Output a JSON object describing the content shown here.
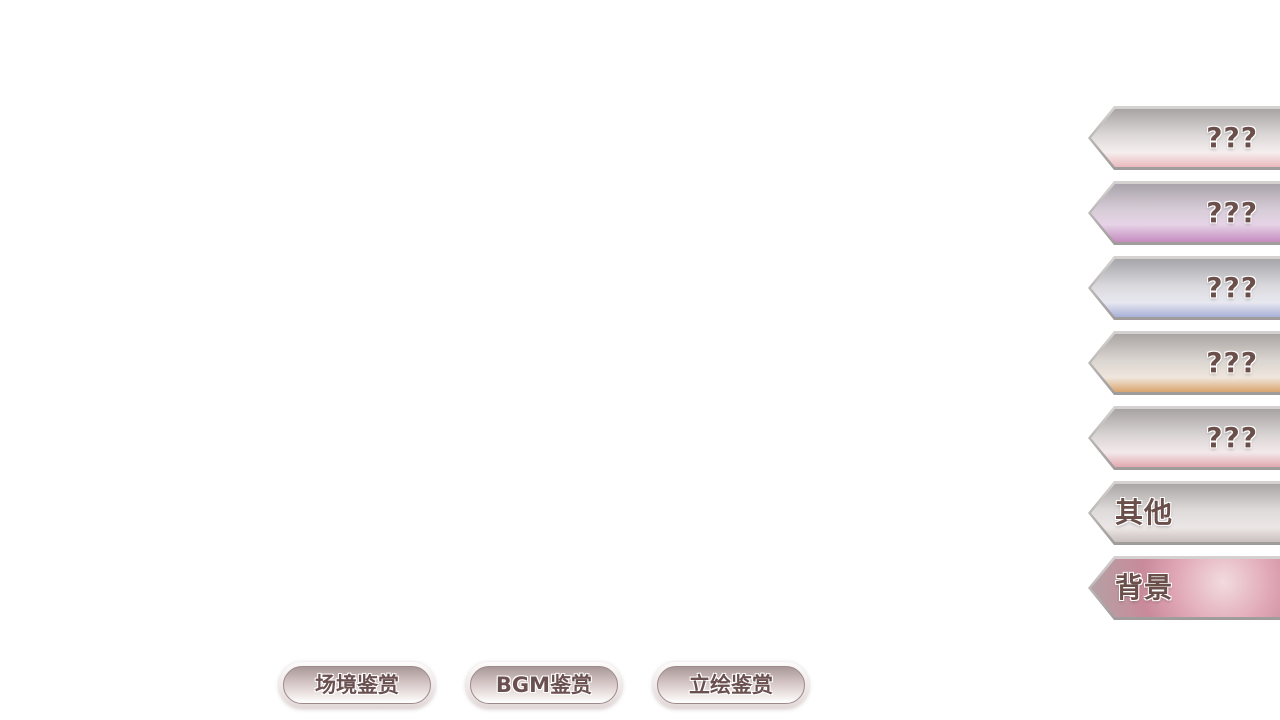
{
  "side_tabs": [
    {
      "label": "???",
      "color": "#e9b9bd"
    },
    {
      "label": "???",
      "color": "#c48bbf"
    },
    {
      "label": "???",
      "color": "#a9b0d8"
    },
    {
      "label": "???",
      "color": "#d9a56e"
    },
    {
      "label": "???",
      "color": "#e2a9b1"
    },
    {
      "label": "其他",
      "color": "#d7cfcf"
    },
    {
      "label": "背景",
      "color": "#d895a8"
    }
  ],
  "bottom_buttons": [
    {
      "label": "场境鉴赏"
    },
    {
      "label": "BGM鉴赏"
    },
    {
      "label": "立绘鉴赏"
    }
  ]
}
